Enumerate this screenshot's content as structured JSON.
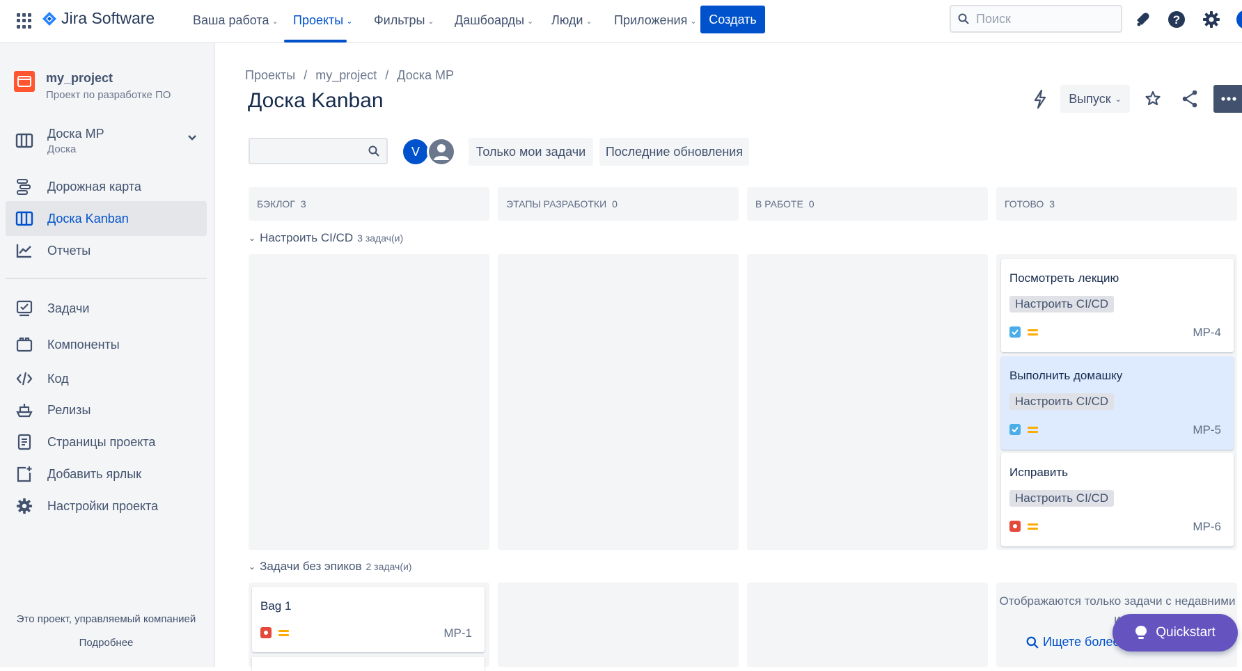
{
  "topnav": {
    "brand": "Jira Software",
    "items": [
      {
        "label": "Ваша работа"
      },
      {
        "label": "Проекты"
      },
      {
        "label": "Фильтры"
      },
      {
        "label": "Дашбоарды"
      },
      {
        "label": "Люди"
      },
      {
        "label": "Приложения"
      }
    ],
    "active_item": "Проекты",
    "create_label": "Создать",
    "search_placeholder": "Поиск"
  },
  "sidebar": {
    "project_name": "my_project",
    "project_type": "Проект по разработке ПО",
    "board_selector": {
      "label": "Доска МР",
      "sub": "Доска"
    },
    "items": [
      {
        "label": "Дорожная карта",
        "icon": "roadmap-icon"
      },
      {
        "label": "Доска Kanban",
        "icon": "board-icon",
        "active": true
      },
      {
        "label": "Отчеты",
        "icon": "reports-icon"
      },
      {
        "label": "Задачи",
        "icon": "issues-icon"
      },
      {
        "label": "Компоненты",
        "icon": "components-icon"
      },
      {
        "label": "Код",
        "icon": "code-icon"
      },
      {
        "label": "Релизы",
        "icon": "releases-icon"
      },
      {
        "label": "Страницы проекта",
        "icon": "pages-icon"
      },
      {
        "label": "Добавить ярлык",
        "icon": "add-shortcut-icon"
      },
      {
        "label": "Настройки проекта",
        "icon": "settings-icon"
      }
    ],
    "footer_text": "Это проект, управляемый компанией",
    "footer_link": "Подробнее"
  },
  "main": {
    "breadcrumb": [
      "Проекты",
      "my_project",
      "Доска МР"
    ],
    "breadcrumb_sep": "/",
    "title": "Доска Kanban",
    "release_label": "Выпуск",
    "avatar_initial": "V",
    "filters": [
      "Только мои задачи",
      "Последние обновления"
    ],
    "columns": [
      {
        "name": "Бэклог",
        "count": "3"
      },
      {
        "name": "Этапы разработки",
        "count": "0"
      },
      {
        "name": "В работе",
        "count": "0"
      },
      {
        "name": "Готово",
        "count": "3"
      }
    ],
    "swimlanes": [
      {
        "name": "Настроить CI/CD",
        "count": "3 задач(и)"
      },
      {
        "name": "Задачи без эпиков",
        "count": "2 задач(и)"
      }
    ],
    "cards_done": [
      {
        "title": "Посмотреть лекцию",
        "epic": "Настроить CI/CD",
        "type": "task",
        "key": "MP-4"
      },
      {
        "title": "Выполнить домашку",
        "epic": "Настроить CI/CD",
        "type": "task",
        "key": "MP-5",
        "selected": true
      },
      {
        "title": "Исправить",
        "epic": "Настроить CI/CD",
        "type": "bug",
        "key": "MP-6"
      }
    ],
    "cards_backlog": [
      {
        "title": "Bag 1",
        "type": "bug",
        "key": "MP-1"
      }
    ],
    "done_note": "Отображаются только задачи с недавними и",
    "done_link": "Ищете более",
    "quickstart_label": "Quickstart"
  },
  "colors": {
    "accent": "#0052cc",
    "quickstart": "#6554c0",
    "task": "#4bade8",
    "bug": "#e5493a",
    "priority": "#ffab00",
    "project_avatar": "#ff5630"
  }
}
